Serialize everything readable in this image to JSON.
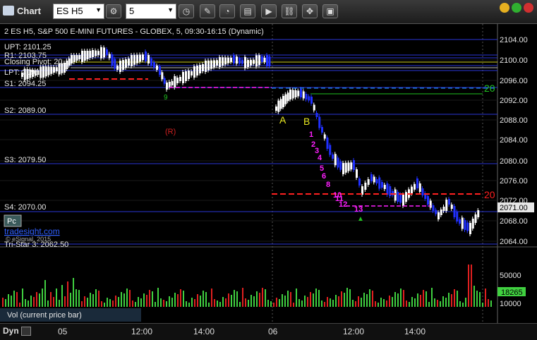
{
  "window": {
    "title": "Chart"
  },
  "toolbar": {
    "symbol": "ES H5",
    "interval": "5"
  },
  "chart": {
    "header": "2 ES H5, S&P 500 E-MINI FUTURES - GLOBEX, 5, 09:30-16:15 (Dynamic)",
    "watermark": "tradesight.com",
    "copyright": "© eSignal, 2015",
    "pc_label": "Pc",
    "annotations": {
      "a": "A",
      "b": "B",
      "r": "(R)",
      "nine": "9",
      "twenty_a": "20",
      "twenty_b": "20"
    },
    "levels": [
      {
        "label": "R1: 2103.75"
      },
      {
        "label": "UPT: 2101.25"
      },
      {
        "label": "Closing Pivot: 20..."
      },
      {
        "label": "LPT: 2096"
      },
      {
        "label": "S1: 2094.25"
      },
      {
        "label": "S2: 2089.00"
      },
      {
        "label": "S3: 2079.50"
      },
      {
        "label": "S4: 2070.00"
      },
      {
        "label": "Tri-Star 3: 2062.50"
      }
    ],
    "sequence_labels": [
      "1",
      "2",
      "3",
      "4",
      "5",
      "6",
      "8",
      "10",
      "11",
      "12",
      "13"
    ],
    "price_axis": [
      "2104.00",
      "2100.00",
      "2096.00",
      "2092.00",
      "2088.00",
      "2084.00",
      "2080.00",
      "2076.00",
      "2072.00",
      "2068.00",
      "2064.00"
    ],
    "last_price": "2071.00",
    "volume_axis": [
      "50000",
      "10000"
    ],
    "volume_last": "18265",
    "volume_label": "Vol (current price bar)",
    "time_axis": [
      "05",
      "12:00",
      "14:00",
      "06",
      "12:00",
      "14:00"
    ]
  },
  "statusbar": {
    "label": "Dyn"
  },
  "colors": {
    "background": "#000000",
    "up": "#ffffff",
    "down": "#2030ff",
    "level": "#2a36d6",
    "red": "#ff2020",
    "magenta": "#ff20ff",
    "green": "#20c020",
    "volume_up": "#40d040",
    "volume_down": "#e02020"
  }
}
